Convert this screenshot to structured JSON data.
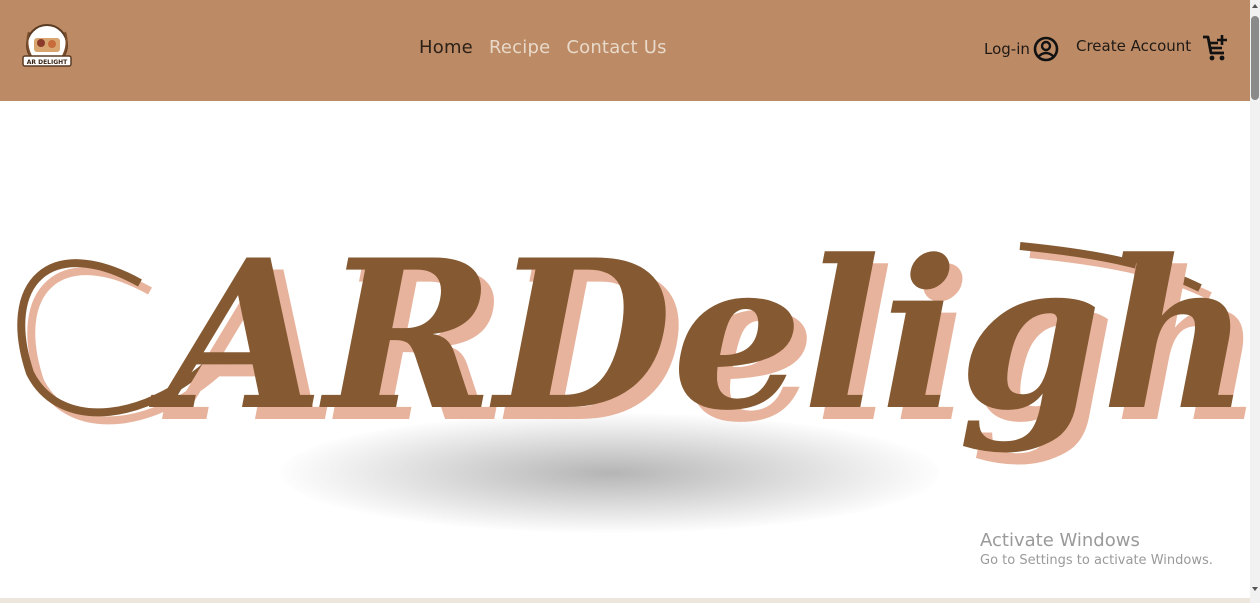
{
  "brand": {
    "logo_text": "AR DELIGHT"
  },
  "nav": {
    "links": [
      {
        "label": "Home"
      },
      {
        "label": "Recipe"
      },
      {
        "label": "Contact Us"
      }
    ]
  },
  "account": {
    "login_label": "Log-in",
    "create_account_label": "Create Account"
  },
  "hero": {
    "title": "ARDelight"
  },
  "watermark": {
    "title": "Activate Windows",
    "subtitle": "Go to Settings to activate Windows."
  },
  "colors": {
    "navbar_bg": "#bc8a65",
    "hero_text": "#855a32",
    "hero_text_shadow": "#e8b39c",
    "active_link": "#2b2118",
    "inactive_link": "#e8d9c9"
  },
  "icons": {
    "user": "user-circle-icon",
    "cart": "cart-plus-icon"
  }
}
